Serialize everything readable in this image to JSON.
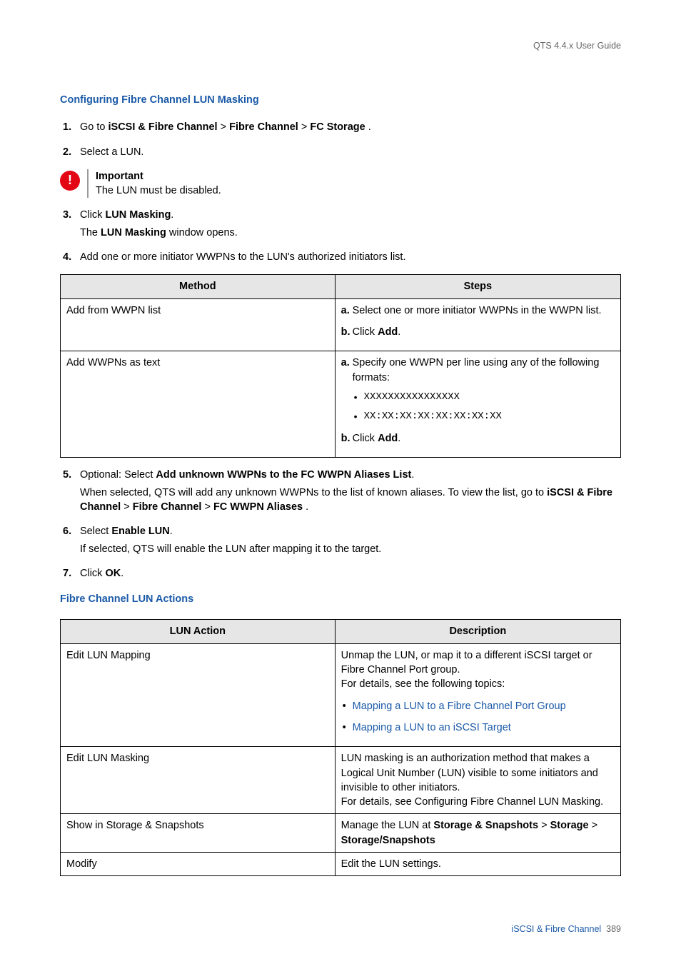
{
  "header": {
    "guide": "QTS 4.4.x User Guide"
  },
  "section1": {
    "title": "Configuring Fibre Channel LUN Masking",
    "step1_a": "Go to ",
    "step1_b": "iSCSI & Fibre Channel",
    "step1_c": " > ",
    "step1_d": "Fibre Channel",
    "step1_e": " > ",
    "step1_f": "FC Storage",
    "step1_g": " .",
    "step2": "Select a LUN.",
    "callout_title": "Important",
    "callout_text": "The LUN must be disabled.",
    "step3_a": "Click ",
    "step3_b": "LUN Masking",
    "step3_c": ".",
    "step3_sub_a": "The ",
    "step3_sub_b": "LUN Masking",
    "step3_sub_c": " window opens.",
    "step4": "Add one or more initiator WWPNs to the LUN's authorized initiators list.",
    "table1": {
      "h1": "Method",
      "h2": "Steps",
      "r1c1": "Add from WWPN list",
      "r1_a": "Select one or more initiator WWPNs in the WWPN list.",
      "r1_b_a": "Click ",
      "r1_b_b": "Add",
      "r1_b_c": ".",
      "r2c1": "Add WWPNs as text",
      "r2_a": "Specify one WWPN per line using any of the following formats:",
      "r2_fmt1": "XXXXXXXXXXXXXXXX",
      "r2_fmt2": "XX:XX:XX:XX:XX:XX:XX:XX",
      "r2_b_a": "Click ",
      "r2_b_b": "Add",
      "r2_b_c": "."
    },
    "step5_a": "Optional: Select ",
    "step5_b": "Add unknown WWPNs to the FC WWPN Aliases List",
    "step5_c": ".",
    "step5_sub_a": "When selected, QTS will add any unknown WWPNs to the list of known aliases. To view the list, go to ",
    "step5_sub_b": "iSCSI & Fibre Channel",
    "step5_sub_c": " > ",
    "step5_sub_d": "Fibre Channel",
    "step5_sub_e": " > ",
    "step5_sub_f": "FC WWPN Aliases",
    "step5_sub_g": " .",
    "step6_a": "Select ",
    "step6_b": "Enable LUN",
    "step6_c": ".",
    "step6_sub": "If selected, QTS will enable the LUN after mapping it to the target.",
    "step7_a": "Click ",
    "step7_b": "OK",
    "step7_c": "."
  },
  "section2": {
    "title": "Fibre Channel LUN Actions",
    "table2": {
      "h1": "LUN Action",
      "h2": "Description",
      "r1c1": "Edit LUN Mapping",
      "r1_d1": "Unmap the LUN, or map it to a different iSCSI target or Fibre Channel Port group.",
      "r1_d2": "For details, see the following topics:",
      "r1_l1": "Mapping a LUN to a Fibre Channel Port Group",
      "r1_l2": "Mapping a LUN to an iSCSI Target",
      "r2c1": "Edit LUN Masking",
      "r2_d1": "LUN masking is an authorization method that makes a Logical Unit Number (LUN) visible to some initiators and invisible to other initiators.",
      "r2_d2": "For details, see Configuring Fibre Channel LUN Masking.",
      "r3c1": "Show in Storage & Snapshots",
      "r3_d_a": "Manage the LUN at ",
      "r3_d_b": "Storage & Snapshots",
      "r3_d_c": " > ",
      "r3_d_d": "Storage",
      "r3_d_e": " > ",
      "r3_d_f": "Storage/Snapshots",
      "r4c1": "Modify",
      "r4_d": "Edit the LUN settings."
    }
  },
  "footer": {
    "section": "iSCSI & Fibre Channel",
    "page": "389"
  }
}
